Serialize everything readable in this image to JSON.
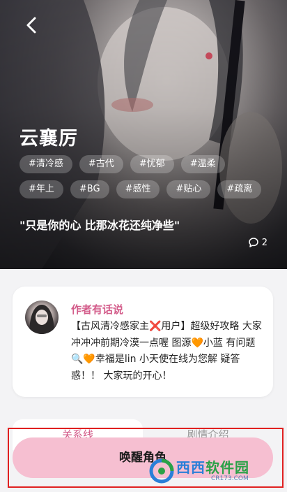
{
  "hero": {
    "name": "云襄厉",
    "tags": [
      "#清冷感",
      "#古代",
      "#忧郁",
      "#温柔",
      "#年上",
      "#BG",
      "#感性",
      "#贴心",
      "#疏离"
    ],
    "quote": "\"只是你的心 比那冰花还纯净些\"",
    "comment_count": "2"
  },
  "author_card": {
    "title": "作者有话说",
    "text": "【古风清冷感家主❌用户】超级好攻略 大家冲冲冲前期冷漠一点喔 图源🧡小蓝 有问题🔍🧡幸福是lin 小天使在线为您解 疑答惑！！ 大家玩的开心！"
  },
  "tabs": [
    "关系线",
    "剧情介绍"
  ],
  "cta_label": "唤醒角色",
  "watermark": {
    "text_blue": "西西",
    "text_green": "软件园",
    "sub": "CR173.COM"
  },
  "colors": {
    "accent": "#d35c8a",
    "cta_bg": "#f6bfd1",
    "highlight": "#e02020"
  }
}
